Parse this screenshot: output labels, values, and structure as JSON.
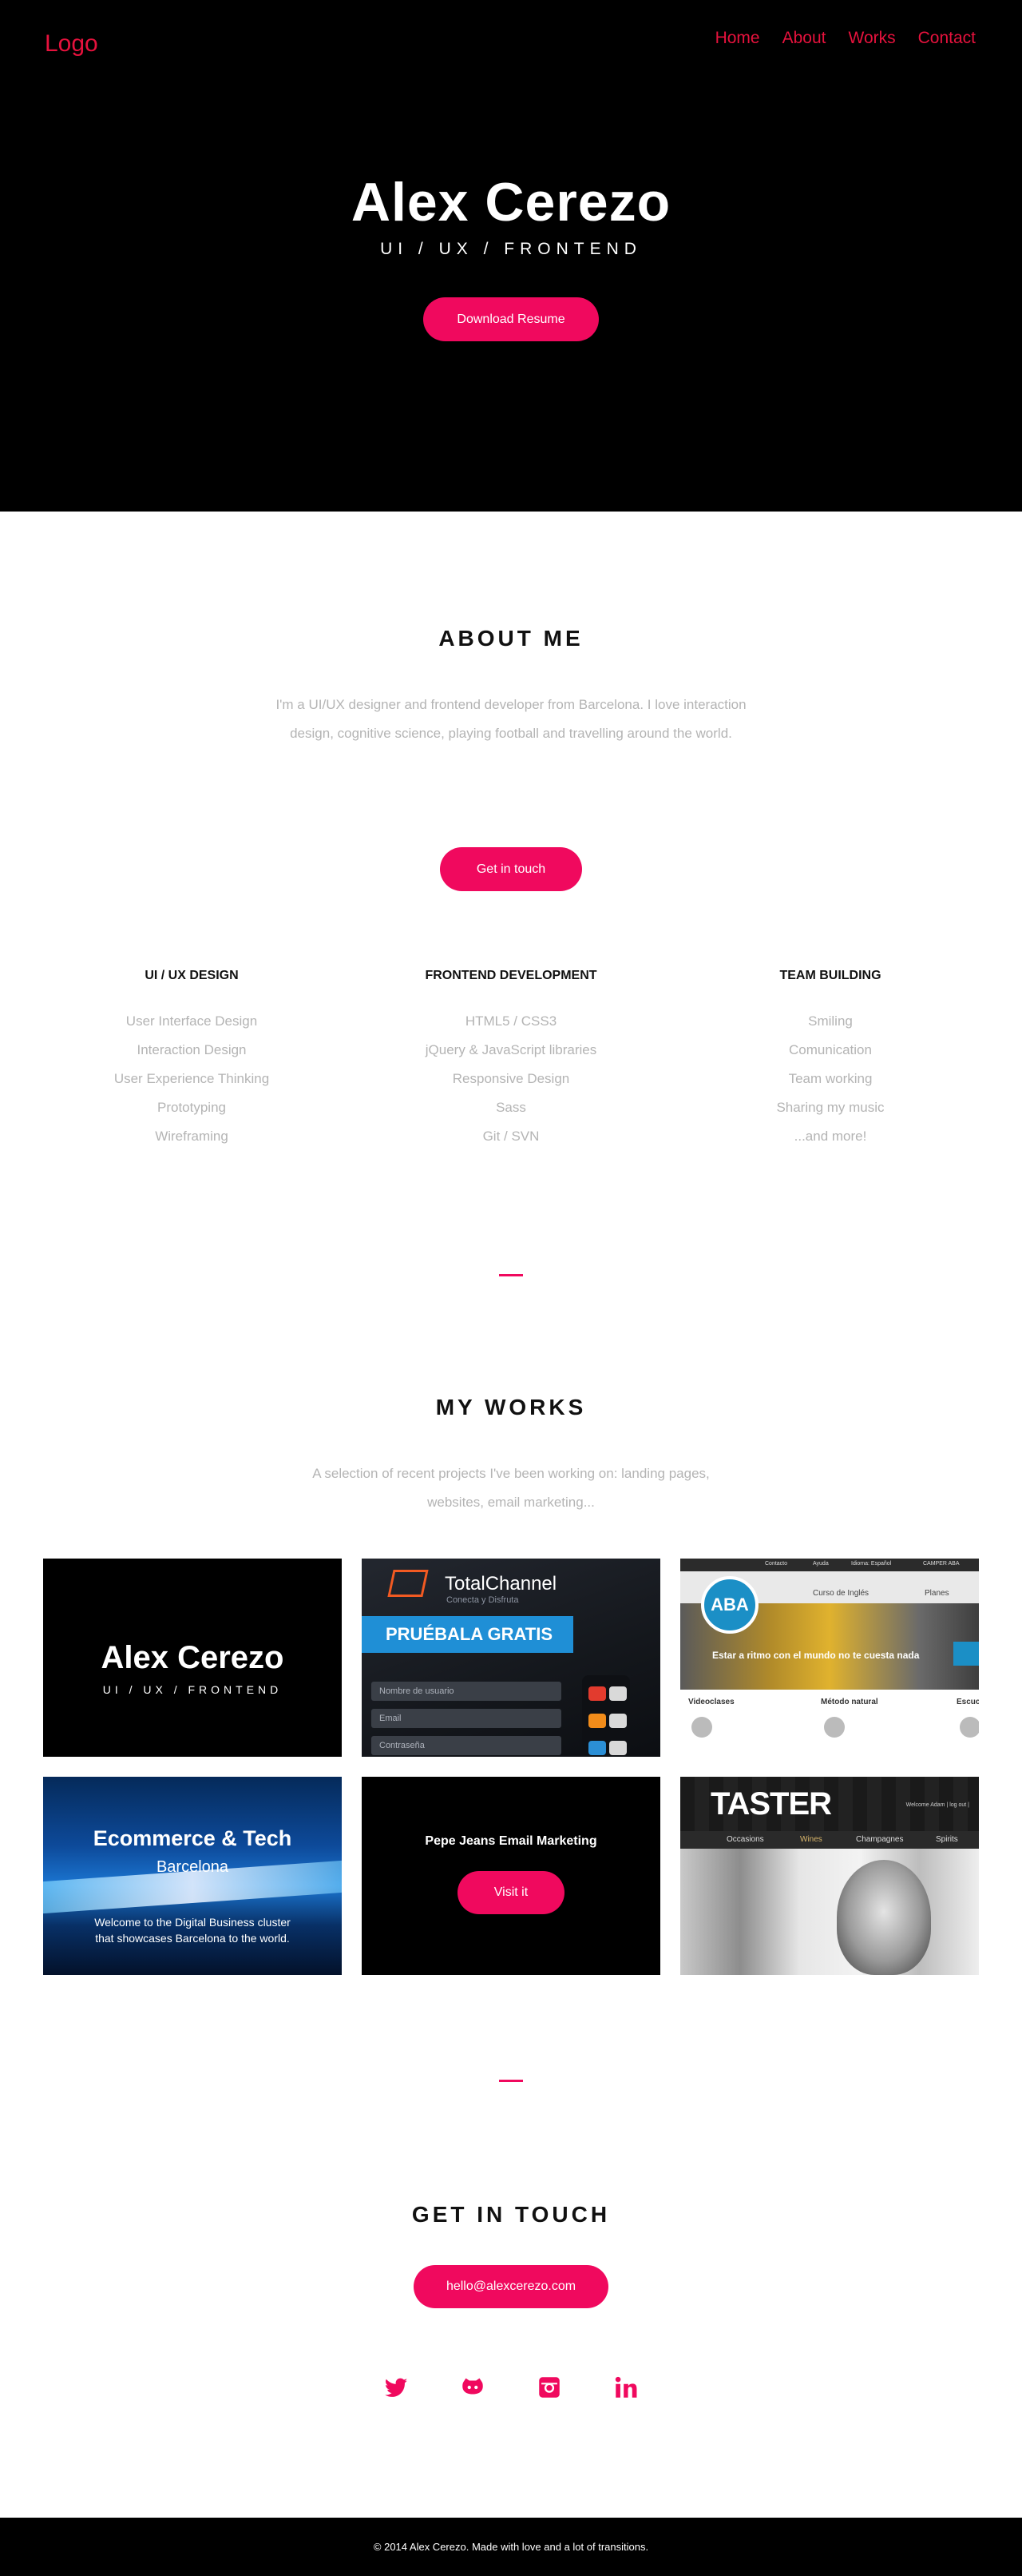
{
  "header": {
    "logo": "Logo",
    "nav": [
      "Home",
      "About",
      "Works",
      "Contact"
    ]
  },
  "hero": {
    "title": "Alex Cerezo",
    "subtitle": "UI / UX / FRONTEND",
    "button": "Download Resume"
  },
  "about": {
    "title": "ABOUT ME",
    "text": "I'm a UI/UX designer and frontend developer from Barcelona. I love interaction design, cognitive science, playing football and travelling around the world.",
    "button": "Get in touch",
    "columns": [
      {
        "heading": "UI / UX DESIGN",
        "items": [
          "User Interface Design",
          "Interaction Design",
          "User Experience Thinking",
          "Prototyping",
          "Wireframing"
        ]
      },
      {
        "heading": "FRONTEND DEVELOPMENT",
        "items": [
          "HTML5 / CSS3",
          "jQuery & JavaScript libraries",
          "Responsive Design",
          "Sass",
          "Git / SVN"
        ]
      },
      {
        "heading": "TEAM BUILDING",
        "items": [
          "Smiling",
          "Comunication",
          "Team working",
          "Sharing my music",
          "...and more!"
        ]
      }
    ]
  },
  "works": {
    "title": "MY WORKS",
    "text": "A selection of recent projects I've been working on: landing pages, websites, email marketing...",
    "card1": {
      "title": "Alex Cerezo",
      "subtitle": "UI / UX / FRONTEND"
    },
    "card2": {
      "brand": "TotalChannel",
      "tagline": "Conecta y Disfruta",
      "banner": "PRUÉBALA GRATIS",
      "fields": [
        "Nombre de usuario",
        "Email",
        "Contraseña"
      ]
    },
    "card3": {
      "topbar": [
        "Contacto",
        "Ayuda",
        "Idioma: Español",
        "CAMPER ABA"
      ],
      "menu": [
        "Curso de Inglés",
        "Planes"
      ],
      "badge": "ABA",
      "headline": "Estar a ritmo con el mundo no te cuesta nada",
      "cols": [
        "Videoclases",
        "Método natural",
        "Escuc"
      ]
    },
    "card4": {
      "title": "Ecommerce & Tech",
      "city": "Barcelona",
      "desc": "Welcome to the Digital Business cluster that showcases Barcelona to the world."
    },
    "card5": {
      "title": "Pepe Jeans Email Marketing",
      "button": "Visit it"
    },
    "card6": {
      "brand": "TASTER",
      "welcome": "Welcome Adam | log out |",
      "tabs": [
        "Occasions",
        "Wines",
        "Champagnes",
        "Spirits"
      ]
    }
  },
  "contact": {
    "title": "GET IN TOUCH",
    "email": "hello@alexcerezo.com",
    "social": [
      "twitter-icon",
      "github-icon",
      "instagram-icon",
      "linkedin-icon"
    ]
  },
  "footer": {
    "text": "© 2014 Alex Cerezo. Made with love and a lot of transitions."
  },
  "colors": {
    "accent": "#f0095e",
    "nav": "#e6123d",
    "muted": "#b4b4b4"
  }
}
